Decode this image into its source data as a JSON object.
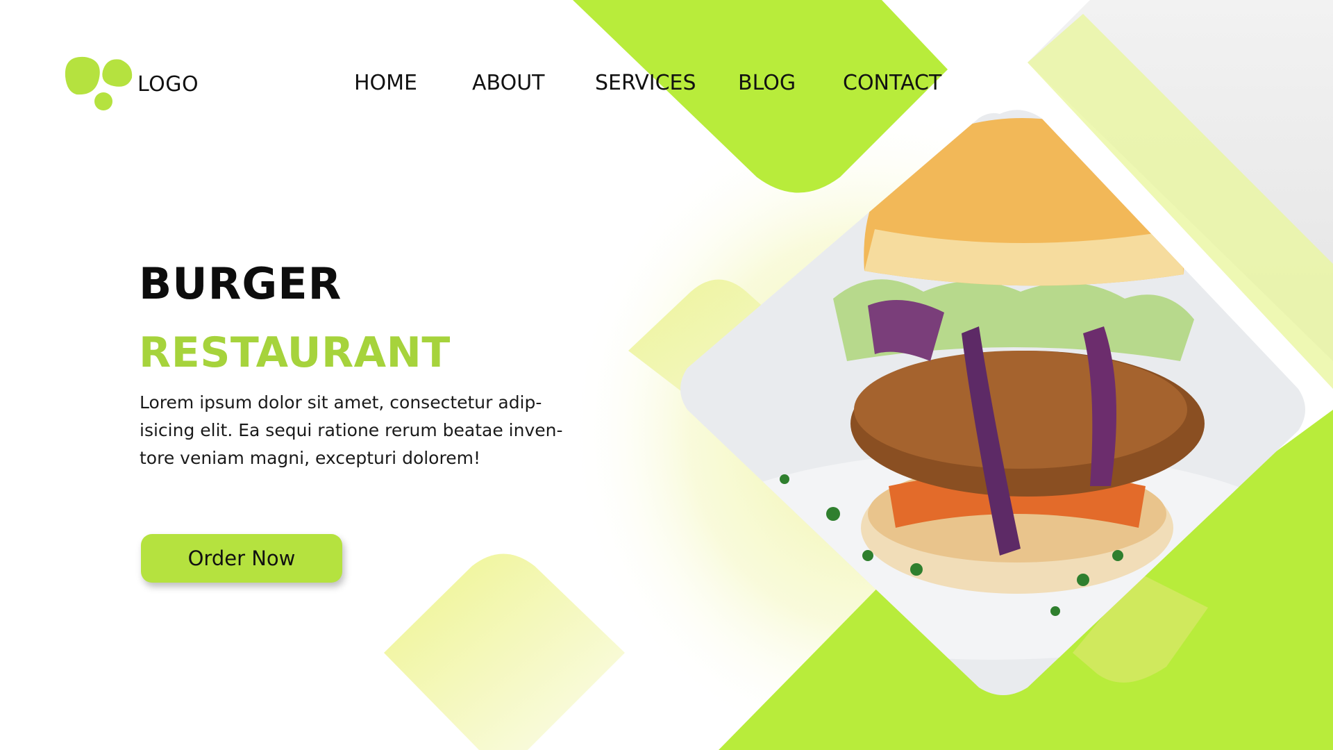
{
  "header": {
    "logo_label": "LOGO",
    "nav": [
      "HOME",
      "ABOUT",
      "SERVICES",
      "BLOG",
      "CONTACT"
    ]
  },
  "hero": {
    "title": "BURGER",
    "subtitle": "RESTAURANT",
    "description_lines": [
      "Lorem ipsum dolor sit amet, consectetur adip-",
      "isicing elit. Ea sequi ratione rerum beatae inven-",
      "tore veniam magni, excepturi dolorem!"
    ],
    "cta_label": "Order Now"
  },
  "image": {
    "subject": "burger-photo"
  },
  "colors": {
    "accent": "#b5ec3c",
    "accent_text": "#a6d33c",
    "pale": "#eef49a",
    "text": "#111111",
    "background": "#ffffff"
  }
}
